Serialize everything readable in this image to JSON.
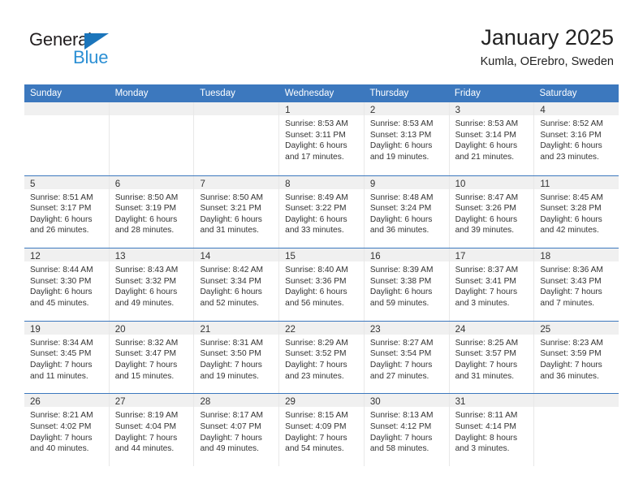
{
  "brand": {
    "name_part1": "General",
    "name_part2": "Blue",
    "accent_color": "#2b8fd4",
    "triangle_color": "#1b75bb"
  },
  "header": {
    "title": "January 2025",
    "subtitle": "Kumla, OErebro, Sweden"
  },
  "calendar": {
    "header_color": "#3C78BE",
    "daynum_band_color": "#f0f0f0",
    "weekdays": [
      "Sunday",
      "Monday",
      "Tuesday",
      "Wednesday",
      "Thursday",
      "Friday",
      "Saturday"
    ],
    "weeks": [
      [
        {
          "day": "",
          "sunrise": "",
          "sunset": "",
          "daylight_line1": "",
          "daylight_line2": ""
        },
        {
          "day": "",
          "sunrise": "",
          "sunset": "",
          "daylight_line1": "",
          "daylight_line2": ""
        },
        {
          "day": "",
          "sunrise": "",
          "sunset": "",
          "daylight_line1": "",
          "daylight_line2": ""
        },
        {
          "day": "1",
          "sunrise": "Sunrise: 8:53 AM",
          "sunset": "Sunset: 3:11 PM",
          "daylight_line1": "Daylight: 6 hours",
          "daylight_line2": "and 17 minutes."
        },
        {
          "day": "2",
          "sunrise": "Sunrise: 8:53 AM",
          "sunset": "Sunset: 3:13 PM",
          "daylight_line1": "Daylight: 6 hours",
          "daylight_line2": "and 19 minutes."
        },
        {
          "day": "3",
          "sunrise": "Sunrise: 8:53 AM",
          "sunset": "Sunset: 3:14 PM",
          "daylight_line1": "Daylight: 6 hours",
          "daylight_line2": "and 21 minutes."
        },
        {
          "day": "4",
          "sunrise": "Sunrise: 8:52 AM",
          "sunset": "Sunset: 3:16 PM",
          "daylight_line1": "Daylight: 6 hours",
          "daylight_line2": "and 23 minutes."
        }
      ],
      [
        {
          "day": "5",
          "sunrise": "Sunrise: 8:51 AM",
          "sunset": "Sunset: 3:17 PM",
          "daylight_line1": "Daylight: 6 hours",
          "daylight_line2": "and 26 minutes."
        },
        {
          "day": "6",
          "sunrise": "Sunrise: 8:50 AM",
          "sunset": "Sunset: 3:19 PM",
          "daylight_line1": "Daylight: 6 hours",
          "daylight_line2": "and 28 minutes."
        },
        {
          "day": "7",
          "sunrise": "Sunrise: 8:50 AM",
          "sunset": "Sunset: 3:21 PM",
          "daylight_line1": "Daylight: 6 hours",
          "daylight_line2": "and 31 minutes."
        },
        {
          "day": "8",
          "sunrise": "Sunrise: 8:49 AM",
          "sunset": "Sunset: 3:22 PM",
          "daylight_line1": "Daylight: 6 hours",
          "daylight_line2": "and 33 minutes."
        },
        {
          "day": "9",
          "sunrise": "Sunrise: 8:48 AM",
          "sunset": "Sunset: 3:24 PM",
          "daylight_line1": "Daylight: 6 hours",
          "daylight_line2": "and 36 minutes."
        },
        {
          "day": "10",
          "sunrise": "Sunrise: 8:47 AM",
          "sunset": "Sunset: 3:26 PM",
          "daylight_line1": "Daylight: 6 hours",
          "daylight_line2": "and 39 minutes."
        },
        {
          "day": "11",
          "sunrise": "Sunrise: 8:45 AM",
          "sunset": "Sunset: 3:28 PM",
          "daylight_line1": "Daylight: 6 hours",
          "daylight_line2": "and 42 minutes."
        }
      ],
      [
        {
          "day": "12",
          "sunrise": "Sunrise: 8:44 AM",
          "sunset": "Sunset: 3:30 PM",
          "daylight_line1": "Daylight: 6 hours",
          "daylight_line2": "and 45 minutes."
        },
        {
          "day": "13",
          "sunrise": "Sunrise: 8:43 AM",
          "sunset": "Sunset: 3:32 PM",
          "daylight_line1": "Daylight: 6 hours",
          "daylight_line2": "and 49 minutes."
        },
        {
          "day": "14",
          "sunrise": "Sunrise: 8:42 AM",
          "sunset": "Sunset: 3:34 PM",
          "daylight_line1": "Daylight: 6 hours",
          "daylight_line2": "and 52 minutes."
        },
        {
          "day": "15",
          "sunrise": "Sunrise: 8:40 AM",
          "sunset": "Sunset: 3:36 PM",
          "daylight_line1": "Daylight: 6 hours",
          "daylight_line2": "and 56 minutes."
        },
        {
          "day": "16",
          "sunrise": "Sunrise: 8:39 AM",
          "sunset": "Sunset: 3:38 PM",
          "daylight_line1": "Daylight: 6 hours",
          "daylight_line2": "and 59 minutes."
        },
        {
          "day": "17",
          "sunrise": "Sunrise: 8:37 AM",
          "sunset": "Sunset: 3:41 PM",
          "daylight_line1": "Daylight: 7 hours",
          "daylight_line2": "and 3 minutes."
        },
        {
          "day": "18",
          "sunrise": "Sunrise: 8:36 AM",
          "sunset": "Sunset: 3:43 PM",
          "daylight_line1": "Daylight: 7 hours",
          "daylight_line2": "and 7 minutes."
        }
      ],
      [
        {
          "day": "19",
          "sunrise": "Sunrise: 8:34 AM",
          "sunset": "Sunset: 3:45 PM",
          "daylight_line1": "Daylight: 7 hours",
          "daylight_line2": "and 11 minutes."
        },
        {
          "day": "20",
          "sunrise": "Sunrise: 8:32 AM",
          "sunset": "Sunset: 3:47 PM",
          "daylight_line1": "Daylight: 7 hours",
          "daylight_line2": "and 15 minutes."
        },
        {
          "day": "21",
          "sunrise": "Sunrise: 8:31 AM",
          "sunset": "Sunset: 3:50 PM",
          "daylight_line1": "Daylight: 7 hours",
          "daylight_line2": "and 19 minutes."
        },
        {
          "day": "22",
          "sunrise": "Sunrise: 8:29 AM",
          "sunset": "Sunset: 3:52 PM",
          "daylight_line1": "Daylight: 7 hours",
          "daylight_line2": "and 23 minutes."
        },
        {
          "day": "23",
          "sunrise": "Sunrise: 8:27 AM",
          "sunset": "Sunset: 3:54 PM",
          "daylight_line1": "Daylight: 7 hours",
          "daylight_line2": "and 27 minutes."
        },
        {
          "day": "24",
          "sunrise": "Sunrise: 8:25 AM",
          "sunset": "Sunset: 3:57 PM",
          "daylight_line1": "Daylight: 7 hours",
          "daylight_line2": "and 31 minutes."
        },
        {
          "day": "25",
          "sunrise": "Sunrise: 8:23 AM",
          "sunset": "Sunset: 3:59 PM",
          "daylight_line1": "Daylight: 7 hours",
          "daylight_line2": "and 36 minutes."
        }
      ],
      [
        {
          "day": "26",
          "sunrise": "Sunrise: 8:21 AM",
          "sunset": "Sunset: 4:02 PM",
          "daylight_line1": "Daylight: 7 hours",
          "daylight_line2": "and 40 minutes."
        },
        {
          "day": "27",
          "sunrise": "Sunrise: 8:19 AM",
          "sunset": "Sunset: 4:04 PM",
          "daylight_line1": "Daylight: 7 hours",
          "daylight_line2": "and 44 minutes."
        },
        {
          "day": "28",
          "sunrise": "Sunrise: 8:17 AM",
          "sunset": "Sunset: 4:07 PM",
          "daylight_line1": "Daylight: 7 hours",
          "daylight_line2": "and 49 minutes."
        },
        {
          "day": "29",
          "sunrise": "Sunrise: 8:15 AM",
          "sunset": "Sunset: 4:09 PM",
          "daylight_line1": "Daylight: 7 hours",
          "daylight_line2": "and 54 minutes."
        },
        {
          "day": "30",
          "sunrise": "Sunrise: 8:13 AM",
          "sunset": "Sunset: 4:12 PM",
          "daylight_line1": "Daylight: 7 hours",
          "daylight_line2": "and 58 minutes."
        },
        {
          "day": "31",
          "sunrise": "Sunrise: 8:11 AM",
          "sunset": "Sunset: 4:14 PM",
          "daylight_line1": "Daylight: 8 hours",
          "daylight_line2": "and 3 minutes."
        },
        {
          "day": "",
          "sunrise": "",
          "sunset": "",
          "daylight_line1": "",
          "daylight_line2": ""
        }
      ]
    ]
  }
}
